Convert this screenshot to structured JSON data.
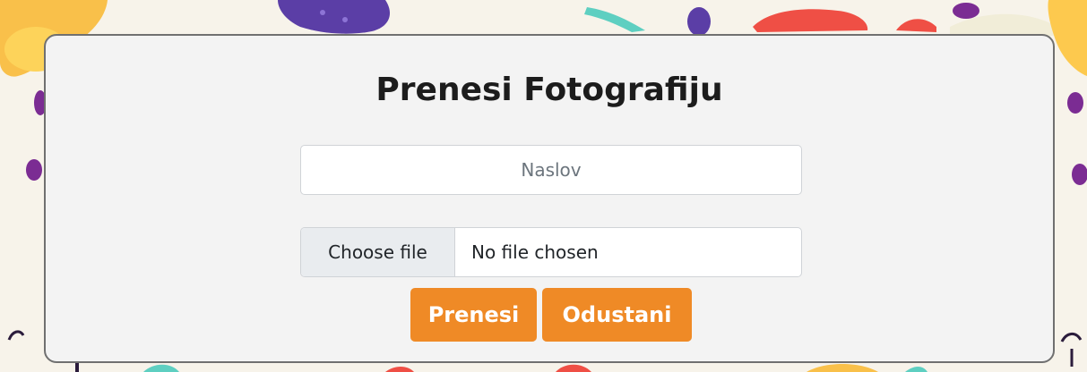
{
  "colors": {
    "accent": "#ef8a26",
    "card_background": "#f3f3f3",
    "card_border": "#707070",
    "page_background": "#f7f3ea"
  },
  "upload_form": {
    "heading": "Prenesi Fotografiju",
    "title_field": {
      "placeholder": "Naslov",
      "value": ""
    },
    "file_input": {
      "button_label": "Choose file",
      "status_text": "No file chosen"
    },
    "buttons": {
      "submit_label": "Prenesi",
      "cancel_label": "Odustani"
    }
  }
}
